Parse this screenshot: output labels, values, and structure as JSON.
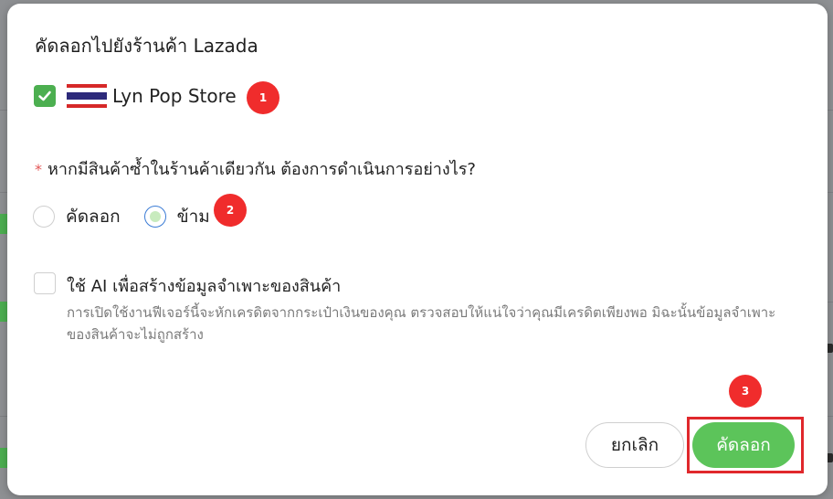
{
  "dialog": {
    "title": "คัดลอกไปยังร้านค้า Lazada",
    "store": {
      "name": "Lyn Pop Store",
      "checked": true,
      "flag_icon": "thailand-flag-icon"
    },
    "question": {
      "required_mark": "*",
      "text": "หากมีสินค้าซ้ำในร้านค้าเดียวกัน ต้องการดำเนินการอย่างไร?"
    },
    "options": [
      {
        "label": "คัดลอก",
        "selected": false
      },
      {
        "label": "ข้าม",
        "selected": true
      }
    ],
    "ai_option": {
      "label": "ใช้ AI เพื่อสร้างข้อมูลจำเพาะของสินค้า",
      "description": "การเปิดใช้งานฟีเจอร์นี้จะหักเครดิตจากกระเป๋าเงินของคุณ ตรวจสอบให้แน่ใจว่าคุณมีเครดิตเพียงพอ มิฉะนั้นข้อมูลจำเพาะของสินค้าจะไม่ถูกสร้าง",
      "checked": false
    },
    "buttons": {
      "cancel": "ยกเลิก",
      "copy": "คัดลอก"
    }
  },
  "annotations": {
    "badge1": "1",
    "badge2": "2",
    "badge3": "3"
  },
  "colors": {
    "accent_green": "#5cc45a",
    "checkbox_green": "#4caf50",
    "badge_red": "#f02c2c",
    "highlight_red": "#e0282c"
  }
}
